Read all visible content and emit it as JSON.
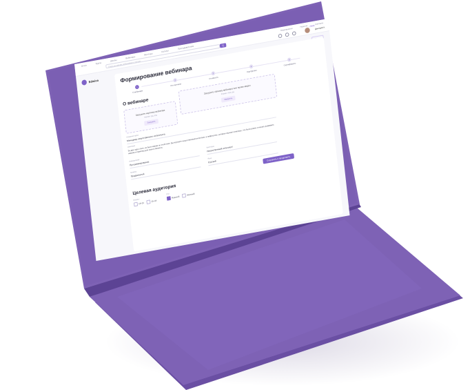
{
  "nav": {
    "links": [
      "Отчёт",
      "Курсы",
      "Шкалы",
      "Вебинары",
      "Менторы"
    ],
    "catalog": "Каталог",
    "programs": "Преподавателям"
  },
  "search": {
    "placeholder": "Поиск по курсам, вебинарам и статьям",
    "button": "Q"
  },
  "rightnav": [
    "Мероприятия",
    "Новости",
    "Контакты"
  ],
  "user": {
    "tag": "Тариф",
    "name": "Дмитрий А."
  },
  "brand": {
    "name": "Edwica"
  },
  "page": {
    "back": "Назад",
    "title": "Формирование вебинара"
  },
  "steps": [
    {
      "n": "1",
      "label": "О вебинаре",
      "active": true
    },
    {
      "n": "2",
      "label": "Что изучаем",
      "active": false
    },
    {
      "n": "3",
      "label": "Стоимость",
      "active": false
    },
    {
      "n": "4",
      "label": "Портфолио",
      "active": false
    },
    {
      "n": "5",
      "label": "Сертификаты",
      "active": false
    }
  ],
  "about": {
    "title": "О вебинаре",
    "cover": {
      "text": "Загрузите картинку вебинара",
      "sub": "Формат: jpg, png",
      "btn": "Загрузить"
    },
    "video": {
      "text": "Загрузите обложку вебинара или промо-видео",
      "sub": "Формат: mp4, jpg",
      "btn": "Загрузить"
    },
    "name_label": "Название курса",
    "name_value": "Менеджер искусственного интеллекта",
    "desc_label": "Описание",
    "desc": "За два года стало, за было время по этой теме. Вы изучаете искусственный интеллект, в нейросетях, которые изучают анализы, что было ранее и начать развивать навыки и практику для своего бизнеса.",
    "f1_label": "Направление",
    "f1_value": "Программирование",
    "f2_label": "Категория",
    "f2_value": "Искусственный интеллект",
    "f3_label": "Уровень",
    "f3_value": "Продвинутый",
    "f4_label": "Язык",
    "f4_value": "Русский",
    "save": "Сохранить и продолжить"
  },
  "audience": {
    "title": "Целевая аудитория",
    "age_label": "Возраст",
    "ages": [
      "18–24",
      "25–34"
    ],
    "gender_label": "Пол",
    "genders": [
      {
        "label": "Мужской",
        "on": true
      },
      {
        "label": "Женский",
        "on": false
      }
    ]
  },
  "colors": {
    "laptop": "#7e62b5",
    "laptop_dark": "#6a4fa3",
    "accent": "#7e62c8",
    "screen_bg": "#f7f7fb"
  }
}
